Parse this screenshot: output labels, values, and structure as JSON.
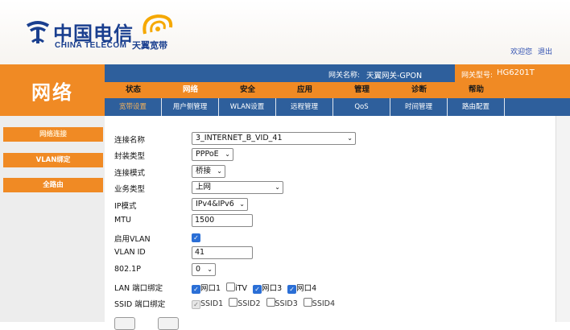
{
  "brand": {
    "cn": "中国电信",
    "en": "CHINA TELECOM",
    "tianyi": "天翼宽带"
  },
  "welcome": {
    "text": "欢迎您",
    "logout": "退出"
  },
  "section_title": "网络",
  "info": {
    "gateway_label": "网关名称:",
    "gateway_value": "天翼网关-GPON",
    "model_label": "网关型号:",
    "model_value": "HG6201T"
  },
  "main_nav": [
    {
      "label": "状态"
    },
    {
      "label": "网络"
    },
    {
      "label": "安全"
    },
    {
      "label": "应用"
    },
    {
      "label": "管理"
    },
    {
      "label": "诊断"
    },
    {
      "label": "帮助"
    }
  ],
  "sub_nav": [
    {
      "label": "宽带设置"
    },
    {
      "label": "用户侧管理"
    },
    {
      "label": "WLAN设置"
    },
    {
      "label": "远程管理"
    },
    {
      "label": "QoS"
    },
    {
      "label": "时间管理"
    },
    {
      "label": "路由配置"
    }
  ],
  "sidebar": [
    {
      "label": "网络连接"
    },
    {
      "label": "VLAN绑定"
    },
    {
      "label": "全路由"
    }
  ],
  "form": {
    "connection_name": {
      "label": "连接名称",
      "value": "3_INTERNET_B_VID_41"
    },
    "encap_type": {
      "label": "封装类型",
      "value": "PPPoE"
    },
    "conn_mode": {
      "label": "连接模式",
      "value": "桥接"
    },
    "service_type": {
      "label": "业务类型",
      "value": "上网"
    },
    "ip_mode": {
      "label": "IP模式",
      "value": "IPv4&IPv6"
    },
    "mtu": {
      "label": "MTU",
      "value": "1500"
    },
    "enable_vlan": {
      "label": "启用VLAN",
      "checked": true
    },
    "vlan_id": {
      "label": "VLAN ID",
      "value": "41"
    },
    "priority": {
      "label": "802.1P",
      "value": "0"
    },
    "lan_binding": {
      "label": "LAN 端口绑定",
      "options": [
        {
          "label": "网口1",
          "checked": true
        },
        {
          "label": "iTV",
          "checked": false
        },
        {
          "label": "网口3",
          "checked": true
        },
        {
          "label": "网口4",
          "checked": true
        }
      ]
    },
    "ssid_binding": {
      "label": "SSID 端口绑定",
      "options": [
        {
          "label": "SSID1",
          "checked": true
        },
        {
          "label": "SSID2",
          "checked": false
        },
        {
          "label": "SSID3",
          "checked": false
        },
        {
          "label": "SSID4",
          "checked": false
        }
      ]
    }
  },
  "colors": {
    "orange": "#f08a24",
    "blue": "#2e5f9c",
    "brand_blue": "#1a3f8f"
  }
}
